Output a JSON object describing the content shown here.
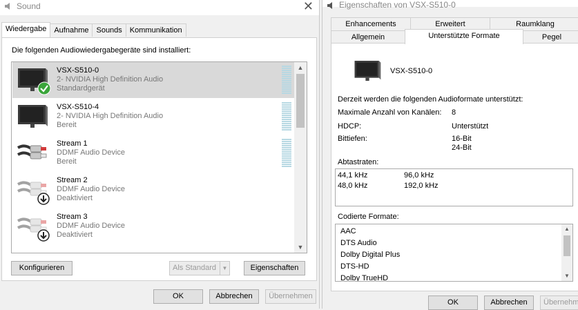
{
  "left": {
    "title": "Sound",
    "tabs": [
      "Wiedergabe",
      "Aufnahme",
      "Sounds",
      "Kommunikation"
    ],
    "instruction": "Die folgenden Audiowiedergabegeräte sind installiert:",
    "devices": [
      {
        "name": "VSX-S510-0",
        "line2": "2- NVIDIA High Definition Audio",
        "line3": "Standardgerät",
        "icon": "monitor-icon",
        "badge": "default-check-icon"
      },
      {
        "name": "VSX-S510-4",
        "line2": "2- NVIDIA High Definition Audio",
        "line3": "Bereit",
        "icon": "monitor-icon"
      },
      {
        "name": "Stream 1",
        "line2": "DDMF Audio Device",
        "line3": "Bereit",
        "icon": "rca-cable-icon"
      },
      {
        "name": "Stream 2",
        "line2": "DDMF Audio Device",
        "line3": "Deaktiviert",
        "icon": "rca-cable-icon",
        "badge": "disabled-arrow-icon"
      },
      {
        "name": "Stream 3",
        "line2": "DDMF Audio Device",
        "line3": "Deaktiviert",
        "icon": "rca-cable-icon",
        "badge": "disabled-arrow-icon"
      }
    ],
    "configure_label": "Konfigurieren",
    "set_default_label": "Als Standard",
    "properties_label": "Eigenschaften",
    "ok_label": "OK",
    "cancel_label": "Abbrechen",
    "apply_label": "Übernehmen"
  },
  "right": {
    "title": "Eigenschaften von VSX-S510-0",
    "tabs_row1": [
      "Enhancements",
      "Erweitert",
      "Raumklang"
    ],
    "tabs_row2": [
      "Allgemein",
      "Unterstützte Formate",
      "Pegel"
    ],
    "device_name": "VSX-S510-0",
    "supported_intro": "Derzeit werden die folgenden Audioformate unterstützt:",
    "max_channels_label": "Maximale Anzahl von Kanälen:",
    "max_channels_value": "8",
    "hdcp_label": "HDCP:",
    "hdcp_value": "Unterstützt",
    "bitdepth_label": "Bittiefen:",
    "bitdepth_values": [
      "16-Bit",
      "24-Bit"
    ],
    "samplerates_label": "Abtastraten:",
    "samplerates": [
      [
        "44,1 kHz",
        "96,0 kHz"
      ],
      [
        "48,0 kHz",
        "192,0 kHz"
      ]
    ],
    "coded_label": "Codierte Formate:",
    "coded_formats": [
      "AAC",
      "DTS Audio",
      "Dolby Digital Plus",
      "DTS-HD",
      "Dolby TrueHD"
    ],
    "ok_label": "OK",
    "cancel_label": "Abbrechen",
    "apply_label": "Übernehmen"
  },
  "colors": {
    "selected_row": "#d9d9d9",
    "check_green": "#3aa53a",
    "meter": "#b7d8e3"
  }
}
